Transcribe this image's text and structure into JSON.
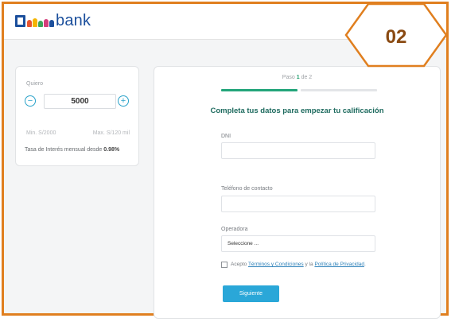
{
  "header": {
    "logo_text": "bank",
    "logo_colors": [
      "#e8542e",
      "#f4b400",
      "#3aa55a",
      "#1b4f9c",
      "#d43c7a"
    ]
  },
  "badge": {
    "label": "02",
    "color": "#e07f1f"
  },
  "simulator": {
    "amount_label": "Quiero",
    "amount_value": "5000",
    "decrement_label": "−",
    "increment_label": "+",
    "min_label": "Min. S/2000",
    "max_label": "Max. S/120 mil",
    "rate_prefix": "Tasa de Interés mensual desde",
    "rate_value": "0.98%"
  },
  "form": {
    "step_prefix": "Paso",
    "step_current": "1",
    "step_suffix": "de 2",
    "progress_fraction": 0.5,
    "title": "Completa tus datos para empezar tu calificación",
    "dni_label": "DNI",
    "dni_value": "",
    "phone_label": "Teléfono de contacto",
    "phone_value": "",
    "operator_label": "Operadora",
    "operator_selected": "Seleccione ...",
    "terms_prefix": "Acepto",
    "terms_link": "Términos y Condiciones",
    "terms_middle": "y la",
    "privacy_link": "Política de Privacidad",
    "terms_end": ".",
    "submit_label": "Siguiente"
  }
}
